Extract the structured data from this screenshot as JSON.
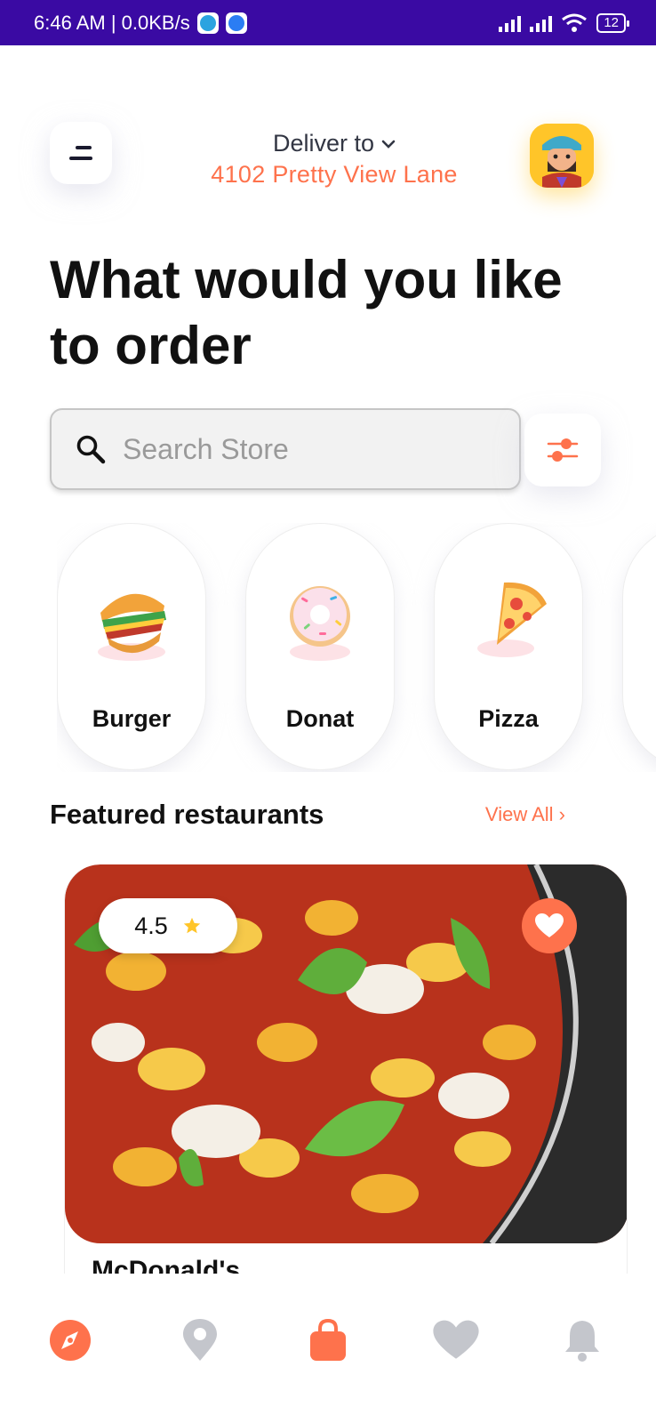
{
  "status_bar": {
    "time": "6:46 AM | 0.0KB/s",
    "battery": "12",
    "icons": [
      "telegram-icon",
      "phone-app-icon",
      "signal-icon",
      "signal-icon",
      "wifi-icon",
      "battery-icon"
    ]
  },
  "header": {
    "menu_icon": "menu-icon",
    "deliver_label": "Deliver to",
    "address": "4102  Pretty View Lane",
    "avatar_icon": "avatar-icon"
  },
  "headline": "What would you like to order",
  "search": {
    "placeholder": "Search Store",
    "value": "",
    "filter_icon": "filter-icon"
  },
  "categories": [
    {
      "label": "Burger",
      "icon": "burger-icon"
    },
    {
      "label": "Donat",
      "icon": "donut-icon"
    },
    {
      "label": "Pizza",
      "icon": "pizza-icon"
    }
  ],
  "featured": {
    "title": "Featured restaurants",
    "view_all": "View All ›",
    "card": {
      "rating": "4.5",
      "name": "McDonald's",
      "favorite": true
    }
  },
  "bottom_nav": [
    {
      "icon": "compass-icon",
      "active": true
    },
    {
      "icon": "location-pin-icon",
      "active": false
    },
    {
      "icon": "shopping-bag-icon",
      "active": true
    },
    {
      "icon": "heart-icon",
      "active": false
    },
    {
      "icon": "bell-icon",
      "active": false
    }
  ],
  "colors": {
    "accent": "#fe724c",
    "status_bar": "#3a0aa3",
    "avatar_bg": "#ffc529",
    "star": "#ffc529",
    "inactive_icon": "#c4c6cc"
  }
}
